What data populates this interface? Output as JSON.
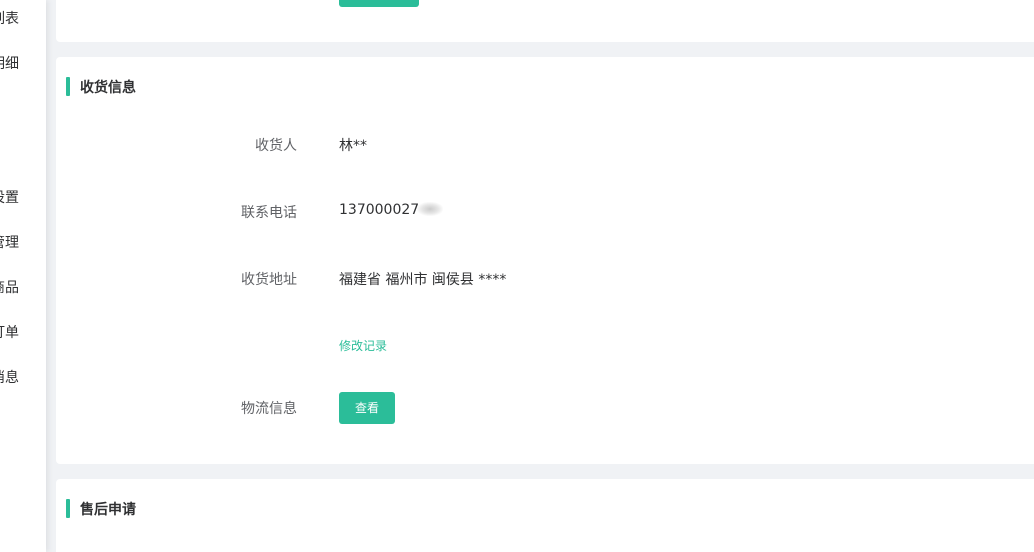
{
  "sidebar": {
    "items": [
      {
        "label": "订单列表"
      },
      {
        "label": "资金明细"
      },
      {
        "label": "店铺设置"
      },
      {
        "label": "账号管理"
      },
      {
        "label": "店铺商品"
      },
      {
        "label": "售后订单"
      },
      {
        "label": "系统消息"
      }
    ]
  },
  "receiver_section": {
    "title": "收货信息",
    "receiver_label": "收货人",
    "receiver_value": "林**",
    "phone_label": "联系电话",
    "phone_value": "137000027",
    "address_label": "收货地址",
    "address_value": "福建省 福州市 闽侯县 ****",
    "history_link": "修改记录",
    "logistics_label": "物流信息",
    "view_button": "查看"
  },
  "after_sale_section": {
    "title": "售后申请"
  },
  "colors": {
    "accent": "#2bbd99",
    "page_bg": "#f0f2f5",
    "label_text": "#606266",
    "value_text": "#303133"
  }
}
